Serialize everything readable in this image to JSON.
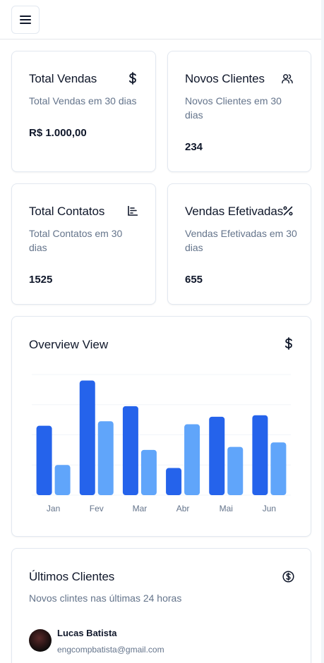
{
  "header": {
    "menu_icon": "menu-icon"
  },
  "stats": [
    {
      "title": "Total Vendas",
      "description": "Total Vendas em 30 dias",
      "value": "R$ 1.000,00",
      "icon": "dollar-icon"
    },
    {
      "title": "Novos Clientes",
      "description": "Novos Clientes em 30 dias",
      "value": "234",
      "icon": "users-icon"
    },
    {
      "title": "Total Contatos",
      "description": "Total Contatos em 30 dias",
      "value": "1525",
      "icon": "bar-list-icon"
    },
    {
      "title": "Vendas Efetivadas",
      "description": "Vendas Efetivadas em 30 dias",
      "value": "655",
      "icon": "percent-icon"
    }
  ],
  "overview": {
    "title": "Overview View",
    "icon": "dollar-icon"
  },
  "chart_data": {
    "type": "bar",
    "categories": [
      "Jan",
      "Fev",
      "Mar",
      "Abr",
      "Mai",
      "Jun"
    ],
    "series": [
      {
        "values": [
          2300,
          3800,
          2950,
          900,
          2600,
          2650
        ]
      },
      {
        "values": [
          1000,
          2450,
          1500,
          2350,
          1600,
          1750
        ]
      }
    ],
    "ylim": [
      0,
      4000
    ],
    "grid": true,
    "colors": [
      "#2563eb",
      "#60a5fa"
    ]
  },
  "clients": {
    "title": "Últimos Clientes",
    "subtitle": "Novos clintes nas últimas 24 horas",
    "icon": "circle-dollar-icon",
    "items": [
      {
        "name": "Lucas Batista",
        "email": "engcompbatista@gmail.com"
      }
    ]
  }
}
